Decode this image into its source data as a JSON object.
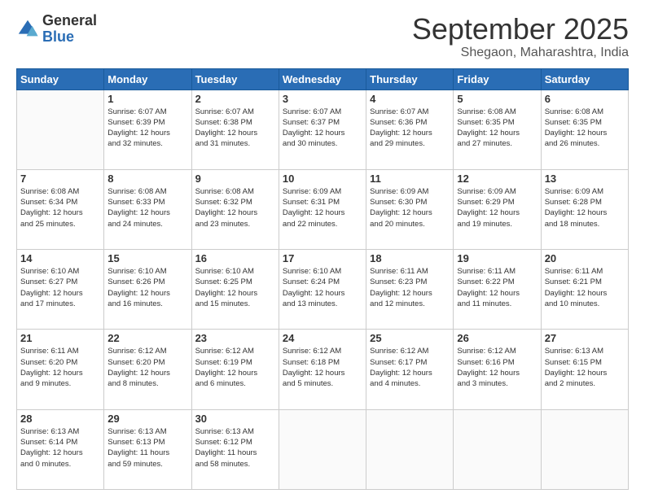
{
  "logo": {
    "general": "General",
    "blue": "Blue"
  },
  "header": {
    "month": "September 2025",
    "location": "Shegaon, Maharashtra, India"
  },
  "weekdays": [
    "Sunday",
    "Monday",
    "Tuesday",
    "Wednesday",
    "Thursday",
    "Friday",
    "Saturday"
  ],
  "weeks": [
    [
      {
        "day": "",
        "info": ""
      },
      {
        "day": "1",
        "info": "Sunrise: 6:07 AM\nSunset: 6:39 PM\nDaylight: 12 hours\nand 32 minutes."
      },
      {
        "day": "2",
        "info": "Sunrise: 6:07 AM\nSunset: 6:38 PM\nDaylight: 12 hours\nand 31 minutes."
      },
      {
        "day": "3",
        "info": "Sunrise: 6:07 AM\nSunset: 6:37 PM\nDaylight: 12 hours\nand 30 minutes."
      },
      {
        "day": "4",
        "info": "Sunrise: 6:07 AM\nSunset: 6:36 PM\nDaylight: 12 hours\nand 29 minutes."
      },
      {
        "day": "5",
        "info": "Sunrise: 6:08 AM\nSunset: 6:35 PM\nDaylight: 12 hours\nand 27 minutes."
      },
      {
        "day": "6",
        "info": "Sunrise: 6:08 AM\nSunset: 6:35 PM\nDaylight: 12 hours\nand 26 minutes."
      }
    ],
    [
      {
        "day": "7",
        "info": "Sunrise: 6:08 AM\nSunset: 6:34 PM\nDaylight: 12 hours\nand 25 minutes."
      },
      {
        "day": "8",
        "info": "Sunrise: 6:08 AM\nSunset: 6:33 PM\nDaylight: 12 hours\nand 24 minutes."
      },
      {
        "day": "9",
        "info": "Sunrise: 6:08 AM\nSunset: 6:32 PM\nDaylight: 12 hours\nand 23 minutes."
      },
      {
        "day": "10",
        "info": "Sunrise: 6:09 AM\nSunset: 6:31 PM\nDaylight: 12 hours\nand 22 minutes."
      },
      {
        "day": "11",
        "info": "Sunrise: 6:09 AM\nSunset: 6:30 PM\nDaylight: 12 hours\nand 20 minutes."
      },
      {
        "day": "12",
        "info": "Sunrise: 6:09 AM\nSunset: 6:29 PM\nDaylight: 12 hours\nand 19 minutes."
      },
      {
        "day": "13",
        "info": "Sunrise: 6:09 AM\nSunset: 6:28 PM\nDaylight: 12 hours\nand 18 minutes."
      }
    ],
    [
      {
        "day": "14",
        "info": "Sunrise: 6:10 AM\nSunset: 6:27 PM\nDaylight: 12 hours\nand 17 minutes."
      },
      {
        "day": "15",
        "info": "Sunrise: 6:10 AM\nSunset: 6:26 PM\nDaylight: 12 hours\nand 16 minutes."
      },
      {
        "day": "16",
        "info": "Sunrise: 6:10 AM\nSunset: 6:25 PM\nDaylight: 12 hours\nand 15 minutes."
      },
      {
        "day": "17",
        "info": "Sunrise: 6:10 AM\nSunset: 6:24 PM\nDaylight: 12 hours\nand 13 minutes."
      },
      {
        "day": "18",
        "info": "Sunrise: 6:11 AM\nSunset: 6:23 PM\nDaylight: 12 hours\nand 12 minutes."
      },
      {
        "day": "19",
        "info": "Sunrise: 6:11 AM\nSunset: 6:22 PM\nDaylight: 12 hours\nand 11 minutes."
      },
      {
        "day": "20",
        "info": "Sunrise: 6:11 AM\nSunset: 6:21 PM\nDaylight: 12 hours\nand 10 minutes."
      }
    ],
    [
      {
        "day": "21",
        "info": "Sunrise: 6:11 AM\nSunset: 6:20 PM\nDaylight: 12 hours\nand 9 minutes."
      },
      {
        "day": "22",
        "info": "Sunrise: 6:12 AM\nSunset: 6:20 PM\nDaylight: 12 hours\nand 8 minutes."
      },
      {
        "day": "23",
        "info": "Sunrise: 6:12 AM\nSunset: 6:19 PM\nDaylight: 12 hours\nand 6 minutes."
      },
      {
        "day": "24",
        "info": "Sunrise: 6:12 AM\nSunset: 6:18 PM\nDaylight: 12 hours\nand 5 minutes."
      },
      {
        "day": "25",
        "info": "Sunrise: 6:12 AM\nSunset: 6:17 PM\nDaylight: 12 hours\nand 4 minutes."
      },
      {
        "day": "26",
        "info": "Sunrise: 6:12 AM\nSunset: 6:16 PM\nDaylight: 12 hours\nand 3 minutes."
      },
      {
        "day": "27",
        "info": "Sunrise: 6:13 AM\nSunset: 6:15 PM\nDaylight: 12 hours\nand 2 minutes."
      }
    ],
    [
      {
        "day": "28",
        "info": "Sunrise: 6:13 AM\nSunset: 6:14 PM\nDaylight: 12 hours\nand 0 minutes."
      },
      {
        "day": "29",
        "info": "Sunrise: 6:13 AM\nSunset: 6:13 PM\nDaylight: 11 hours\nand 59 minutes."
      },
      {
        "day": "30",
        "info": "Sunrise: 6:13 AM\nSunset: 6:12 PM\nDaylight: 11 hours\nand 58 minutes."
      },
      {
        "day": "",
        "info": ""
      },
      {
        "day": "",
        "info": ""
      },
      {
        "day": "",
        "info": ""
      },
      {
        "day": "",
        "info": ""
      }
    ]
  ]
}
